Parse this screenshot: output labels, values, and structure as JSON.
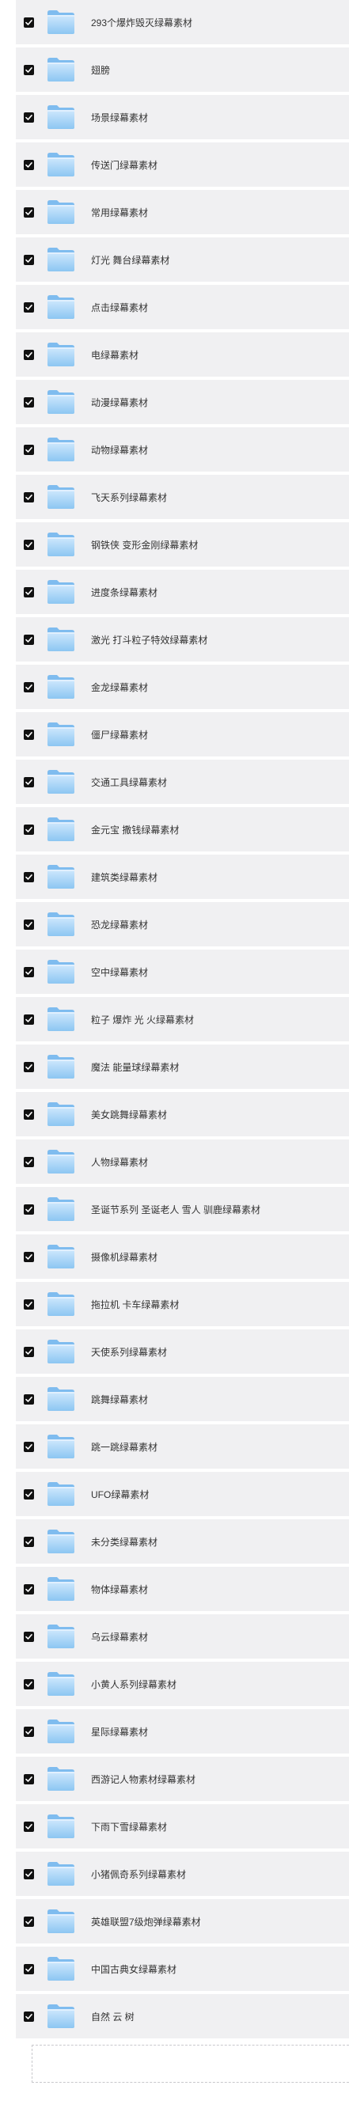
{
  "files": [
    {
      "name": "293个爆炸毁灭绿幕素材",
      "checked": true
    },
    {
      "name": "翅膀",
      "checked": true
    },
    {
      "name": "场景绿幕素材",
      "checked": true
    },
    {
      "name": "传送门绿幕素材",
      "checked": true
    },
    {
      "name": "常用绿幕素材",
      "checked": true
    },
    {
      "name": "灯光 舞台绿幕素材",
      "checked": true
    },
    {
      "name": "点击绿幕素材",
      "checked": true
    },
    {
      "name": "电绿幕素材",
      "checked": true
    },
    {
      "name": "动漫绿幕素材",
      "checked": true
    },
    {
      "name": "动物绿幕素材",
      "checked": true
    },
    {
      "name": "飞天系列绿幕素材",
      "checked": true
    },
    {
      "name": "钢铁侠 变形金刚绿幕素材",
      "checked": true
    },
    {
      "name": "进度条绿幕素材",
      "checked": true
    },
    {
      "name": "激光 打斗粒子特效绿幕素材",
      "checked": true
    },
    {
      "name": "金龙绿幕素材",
      "checked": true
    },
    {
      "name": "僵尸绿幕素材",
      "checked": true
    },
    {
      "name": "交通工具绿幕素材",
      "checked": true
    },
    {
      "name": "金元宝 撒钱绿幕素材",
      "checked": true
    },
    {
      "name": "建筑类绿幕素材",
      "checked": true
    },
    {
      "name": "恐龙绿幕素材",
      "checked": true
    },
    {
      "name": "空中绿幕素材",
      "checked": true
    },
    {
      "name": "粒子 爆炸 光 火绿幕素材",
      "checked": true
    },
    {
      "name": "魔法 能量球绿幕素材",
      "checked": true
    },
    {
      "name": "美女跳舞绿幕素材",
      "checked": true
    },
    {
      "name": "人物绿幕素材",
      "checked": true
    },
    {
      "name": "圣诞节系列 圣诞老人 雪人 驯鹿绿幕素材",
      "checked": true
    },
    {
      "name": "摄像机绿幕素材",
      "checked": true
    },
    {
      "name": "拖拉机 卡车绿幕素材",
      "checked": true
    },
    {
      "name": "天使系列绿幕素材",
      "checked": true
    },
    {
      "name": "跳舞绿幕素材",
      "checked": true
    },
    {
      "name": "跳一跳绿幕素材",
      "checked": true
    },
    {
      "name": "UFO绿幕素材",
      "checked": true
    },
    {
      "name": "未分类绿幕素材",
      "checked": true
    },
    {
      "name": "物体绿幕素材",
      "checked": true
    },
    {
      "name": "乌云绿幕素材",
      "checked": true
    },
    {
      "name": "小黄人系列绿幕素材",
      "checked": true
    },
    {
      "name": "星际绿幕素材",
      "checked": true
    },
    {
      "name": "西游记人物素材绿幕素材",
      "checked": true
    },
    {
      "name": "下雨下雪绿幕素材",
      "checked": true
    },
    {
      "name": "小猪佩奇系列绿幕素材",
      "checked": true
    },
    {
      "name": "英雄联盟7级炮弹绿幕素材",
      "checked": true
    },
    {
      "name": "中国古典女绿幕素材",
      "checked": true
    },
    {
      "name": "自然 云 树",
      "checked": true
    }
  ],
  "icons": {
    "checkbox": "checkmark-icon",
    "folder": "folder-icon"
  },
  "colors": {
    "row_bg": "#f0f0f2",
    "checkbox": "#111111",
    "folder_light": "#bfe0fb",
    "folder_dark": "#7fbcef"
  }
}
